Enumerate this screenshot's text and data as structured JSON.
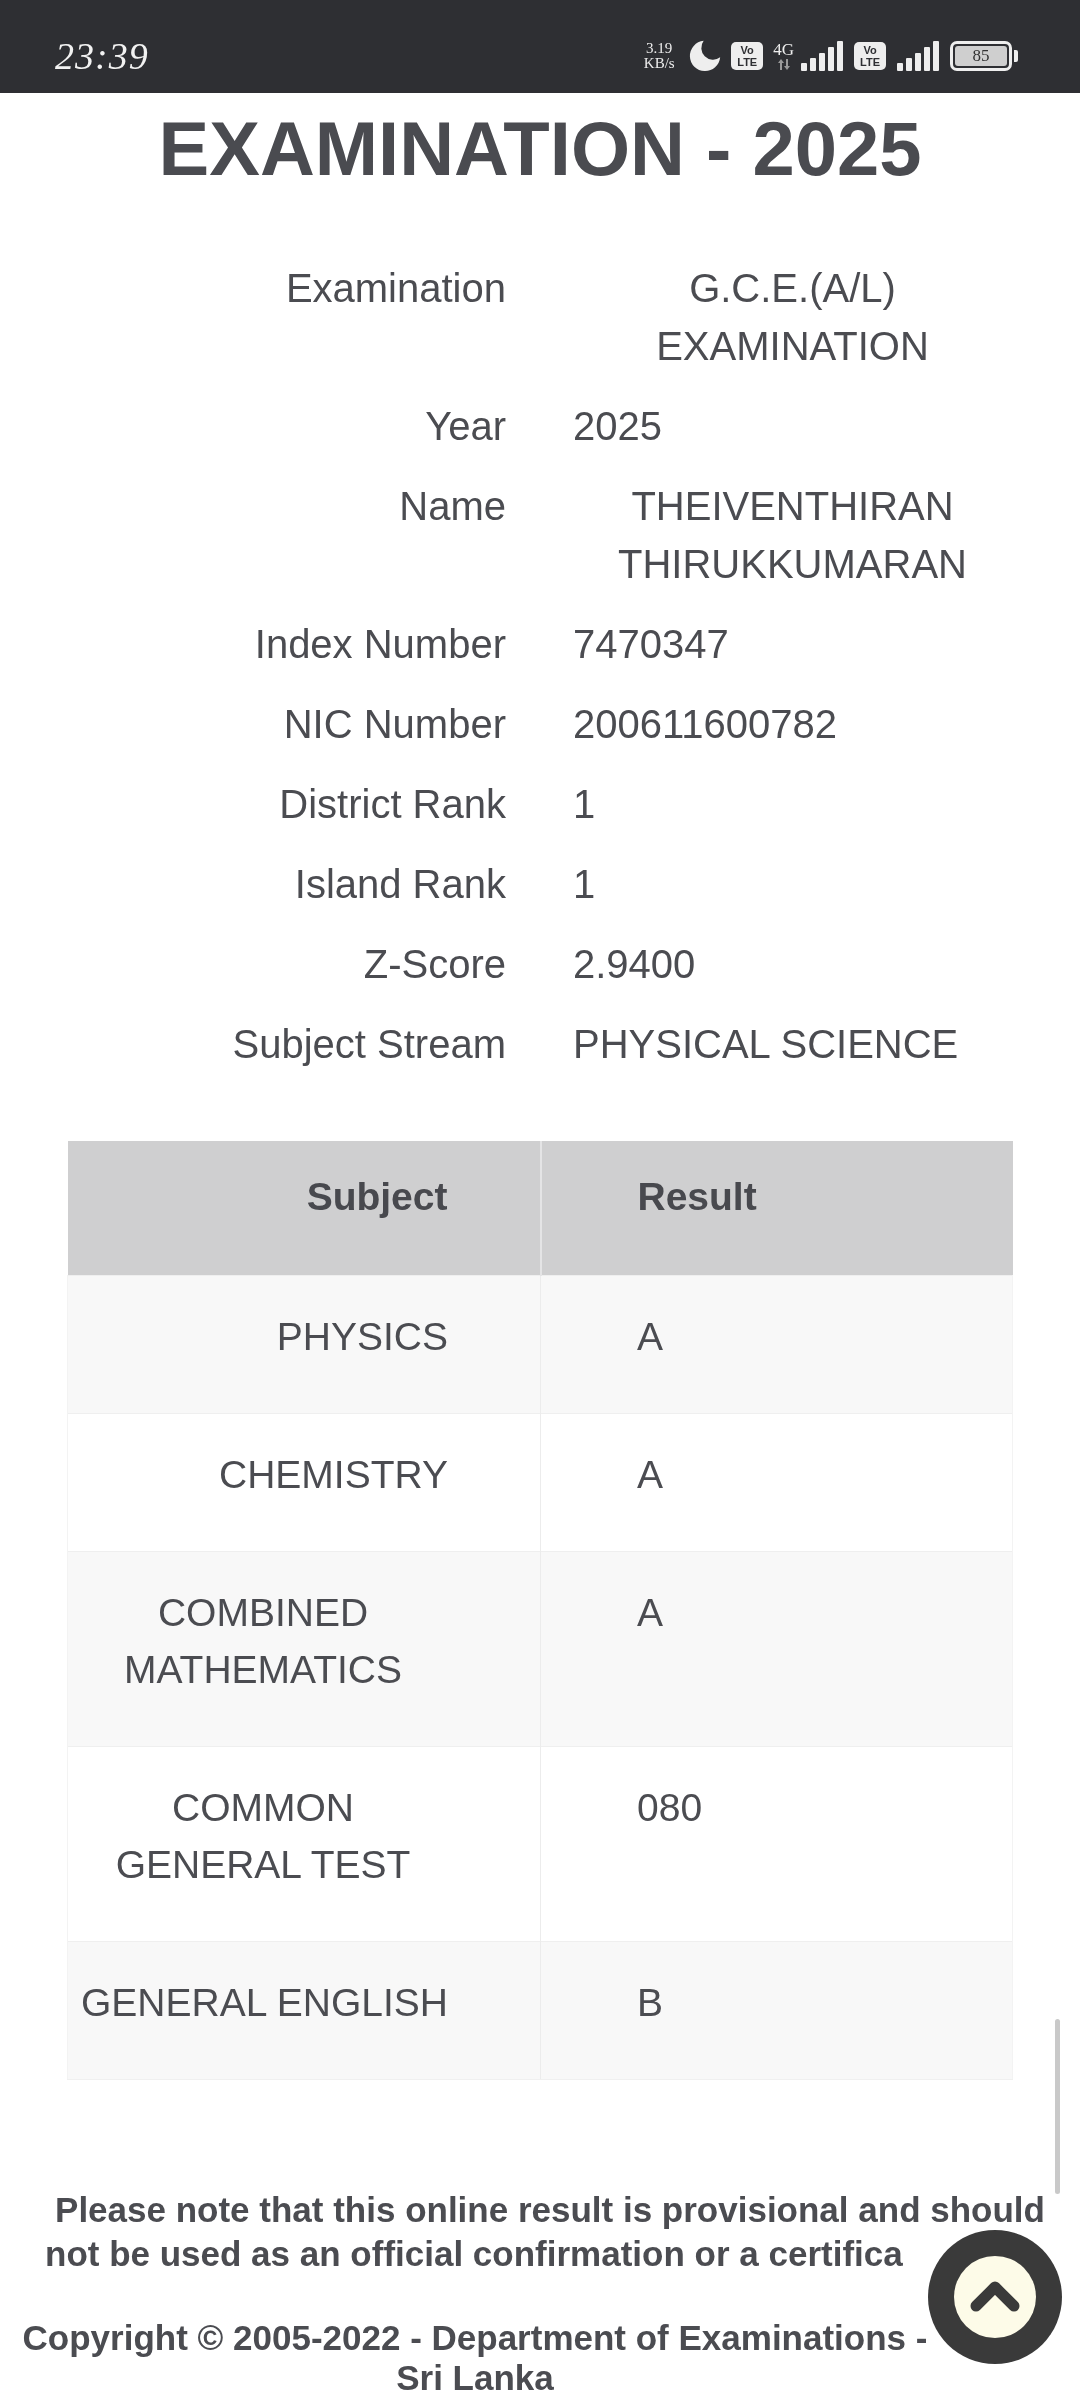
{
  "status_bar": {
    "time": "23:39",
    "net_speed": "3.19 KB/s",
    "sims": [
      {
        "badge": "Vo LTE",
        "network": "4G"
      },
      {
        "badge": "Vo LTE"
      }
    ],
    "battery": "85"
  },
  "heading": "EXAMINATION - 2025",
  "details": [
    {
      "label": "Examination",
      "value": "G.C.E.(A/L) EXAMINATION"
    },
    {
      "label": "Year",
      "value": "2025"
    },
    {
      "label": "Name",
      "value": "THEIVENTHIRAN THIRUKKUMARAN"
    },
    {
      "label": "Index Number",
      "value": "7470347"
    },
    {
      "label": "NIC Number",
      "value": "200611600782"
    },
    {
      "label": "District Rank",
      "value": "1"
    },
    {
      "label": "Island Rank",
      "value": "1"
    },
    {
      "label": "Z-Score",
      "value": "2.9400"
    },
    {
      "label": "Subject Stream",
      "value": "PHYSICAL SCIENCE"
    }
  ],
  "results_table": {
    "columns": [
      "Subject",
      "Result"
    ],
    "rows": [
      {
        "subject": "PHYSICS",
        "result": "A"
      },
      {
        "subject": "CHEMISTRY",
        "result": "A"
      },
      {
        "subject": "COMBINED MATHEMATICS",
        "result": "A"
      },
      {
        "subject": "COMMON GENERAL TEST",
        "result": "080"
      },
      {
        "subject": "GENERAL ENGLISH",
        "result": "B"
      }
    ]
  },
  "notice": "Please note that this online result is provisional and should not be used as an official confirmation or a certifica",
  "copyright": "Copyright © 2005-2022 - Department of Examinations - Sri Lanka"
}
